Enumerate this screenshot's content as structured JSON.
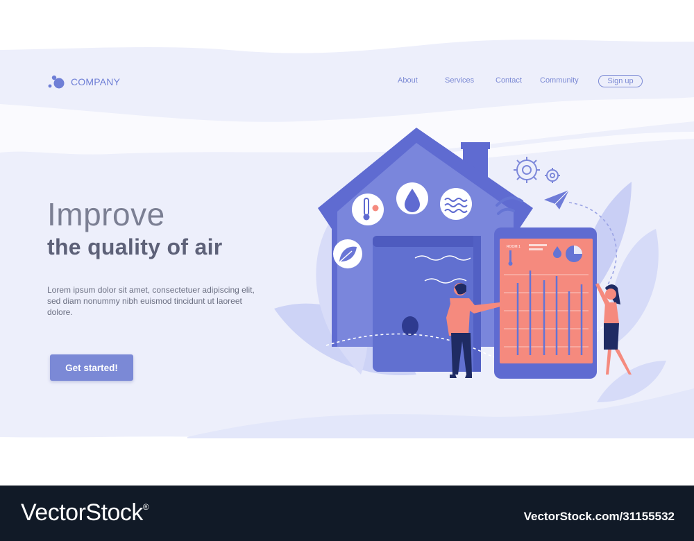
{
  "brand": {
    "name": "COMPANY",
    "icon": "bubbles-logo-icon",
    "color": "#6f7fd6"
  },
  "nav": {
    "items": [
      {
        "label": "About"
      },
      {
        "label": "Services"
      },
      {
        "label": "Contact"
      },
      {
        "label": "Community"
      }
    ],
    "signup_label": "Sign up"
  },
  "hero": {
    "title_line1": "Improve",
    "title_line2": "the quality of air",
    "description": "Lorem ipsum dolor sit amet, consectetuer adipiscing elit, sed diam nonummy nibh euismod tincidunt ut laoreet dolore.",
    "cta_label": "Get started!"
  },
  "illustration": {
    "tablet_header": "ROOM 1",
    "icons": [
      "thermometer-icon",
      "water-drop-icon",
      "wind-waves-icon",
      "leaf-icon",
      "wifi-icon",
      "gear-icon",
      "paper-plane-icon",
      "pie-chart-icon"
    ]
  },
  "colors": {
    "accent": "#7b89d6",
    "house": "#5f6bd1",
    "device": "#f58a7e",
    "bg_light": "#e9ecfb"
  },
  "watermark": {
    "logo": "VectorStock",
    "registered": "®",
    "url": "VectorStock.com/31155532"
  }
}
